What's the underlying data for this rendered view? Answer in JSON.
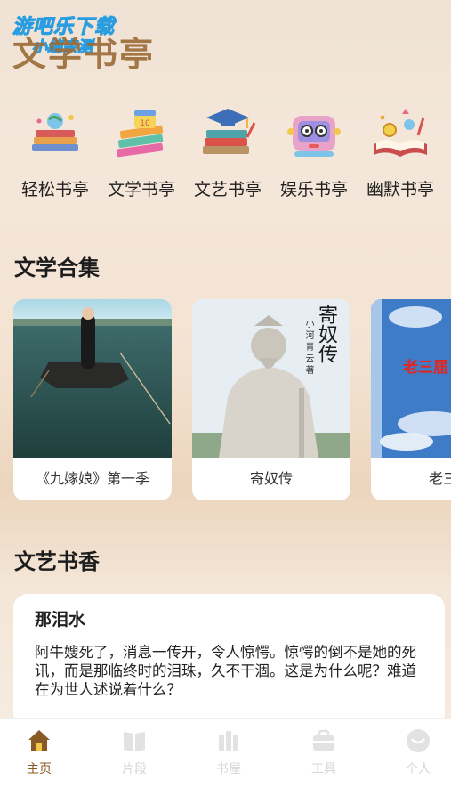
{
  "watermark": {
    "line1": "游吧乐下载",
    "line2": "小编亲测"
  },
  "app_title": "文学书亭",
  "categories": [
    {
      "label": "轻松书亭",
      "icon": "books-globe-icon"
    },
    {
      "label": "文学书亭",
      "icon": "books-calendar-icon"
    },
    {
      "label": "文艺书亭",
      "icon": "graduation-books-icon"
    },
    {
      "label": "娱乐书亭",
      "icon": "robot-glasses-icon"
    },
    {
      "label": "幽默书亭",
      "icon": "open-book-icon"
    }
  ],
  "collection": {
    "title": "文学合集",
    "books": [
      {
        "name": "《九嫁娘》第一季"
      },
      {
        "name": "寄奴传",
        "cover_title": "寄奴传",
        "cover_author": "小河青云著"
      },
      {
        "name": "老三届",
        "cover_title": "老三届"
      }
    ]
  },
  "excerpt_section": {
    "title": "文艺书香",
    "card": {
      "title": "那泪水",
      "body": "阿牛嫂死了，消息一传开，令人惊愕。惊愕的倒不是她的死讯，而是那临终时的泪珠，久不干涸。这是为什么呢？难道在为世人述说着什么？"
    }
  },
  "tabbar": [
    {
      "label": "主页",
      "icon": "home-icon",
      "active": true
    },
    {
      "label": "片段",
      "icon": "book-open-icon",
      "active": false
    },
    {
      "label": "书屋",
      "icon": "bookshelf-icon",
      "active": false
    },
    {
      "label": "工具",
      "icon": "briefcase-icon",
      "active": false
    },
    {
      "label": "个人",
      "icon": "user-icon",
      "active": false
    }
  ],
  "colors": {
    "accent": "#8a5a26",
    "inactive_tab": "#d7d7d7",
    "title_brown": "#9a6b36"
  }
}
